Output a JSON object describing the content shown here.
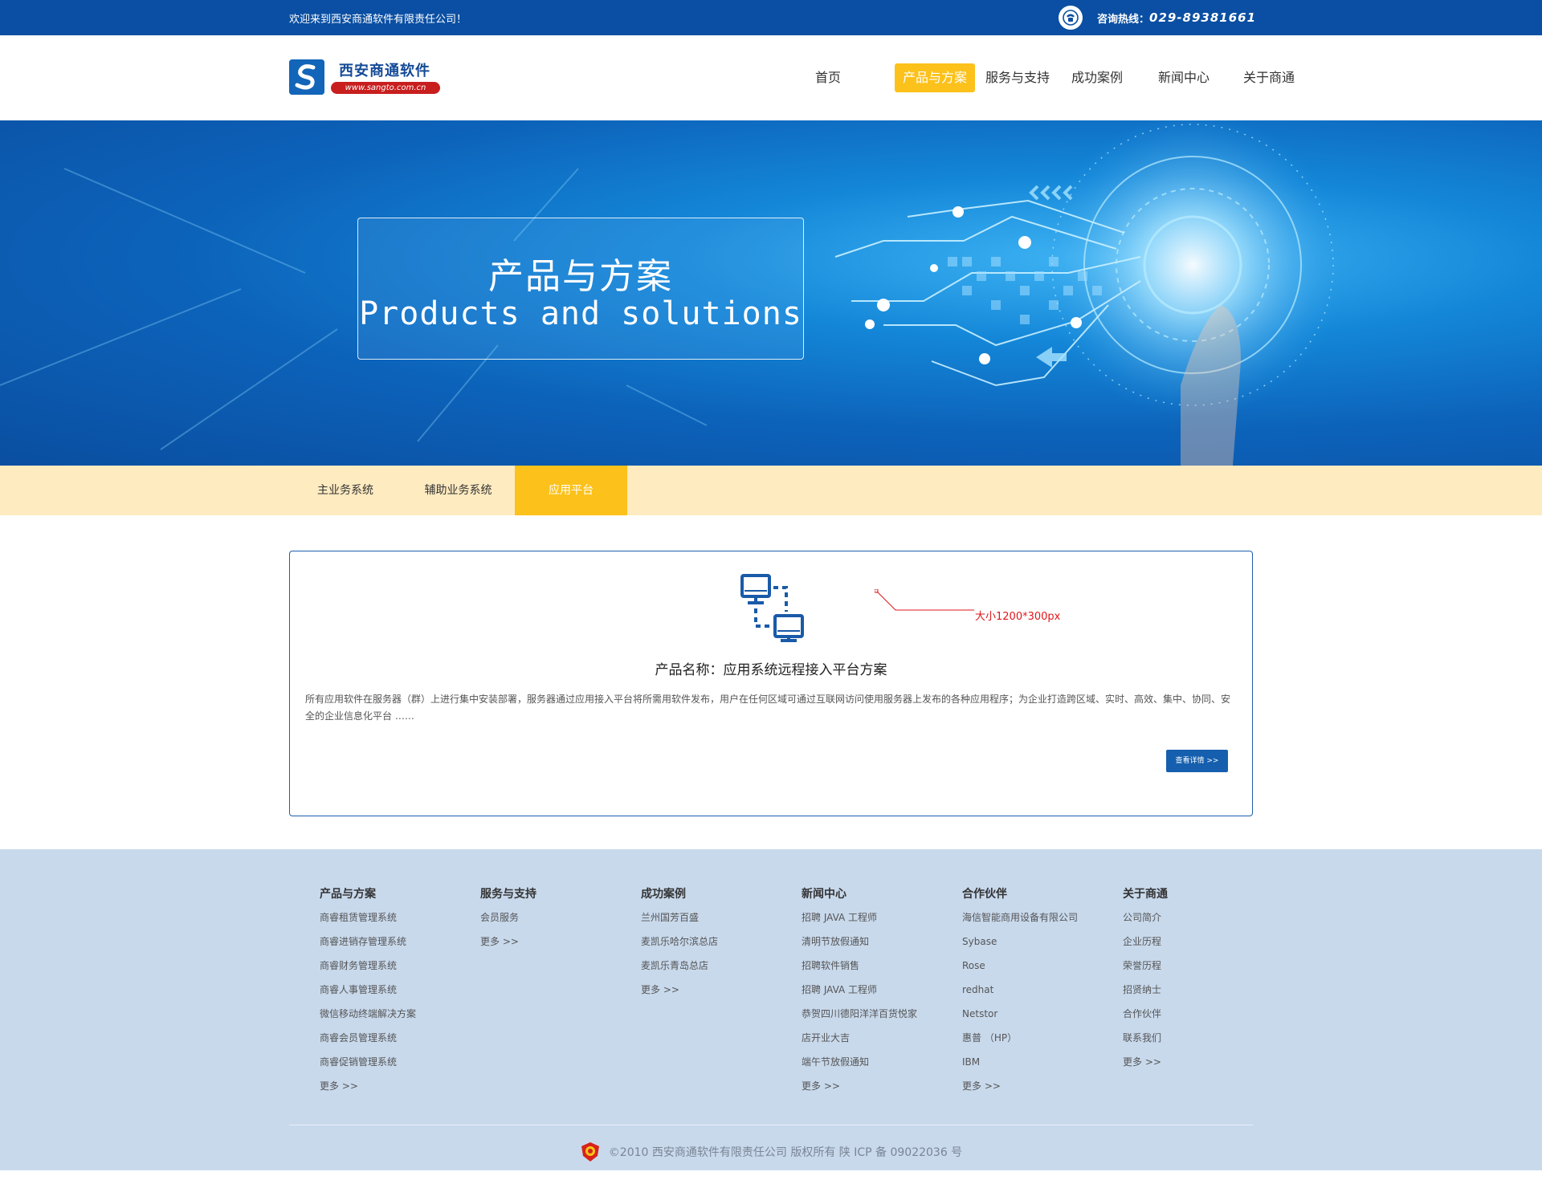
{
  "topbar": {
    "welcome": "欢迎来到西安商通软件有限责任公司！",
    "hotline_label": "咨询热线：",
    "hotline_number": "029-89381661",
    "phone_icon": "phone-icon"
  },
  "header": {
    "logo_name": "西安商通软件",
    "logo_url": "www.sangto.com.cn",
    "nav": [
      {
        "label": "首页",
        "active": false
      },
      {
        "label": "产品与方案",
        "active": true
      },
      {
        "label": "服务与支持",
        "active": false
      },
      {
        "label": "成功案例",
        "active": false
      },
      {
        "label": "新闻中心",
        "active": false
      },
      {
        "label": "关于商通",
        "active": false
      }
    ]
  },
  "banner": {
    "title": "产品与方案",
    "subtitle": "Products and solutions"
  },
  "subtabs": [
    {
      "label": "主业务系统",
      "active": false
    },
    {
      "label": "辅助业务系统",
      "active": false
    },
    {
      "label": "应用平台",
      "active": true
    }
  ],
  "card": {
    "annotation": "大小1200*300px",
    "product_name": "产品名称：应用系统远程接入平台方案",
    "description": "所有应用软件在服务器（群）上进行集中安装部署，服务器通过应用接入平台将所需用软件发布，用户在任何区域可通过互联网访问使用服务器上发布的各种应用程序；为企业打造跨区域、实时、高效、集中、协同、安全的企业信息化平台 ……",
    "detail_button": "查看详情 >>"
  },
  "footer": {
    "columns": [
      {
        "title": "产品与方案",
        "links": [
          "商睿租赁管理系统",
          "商睿进销存管理系统",
          "商睿财务管理系统",
          "商睿人事管理系统",
          "微信移动终端解决方案",
          "商睿会员管理系统",
          "商睿促销管理系统",
          "更多 >>"
        ]
      },
      {
        "title": "服务与支持",
        "links": [
          "会员服务",
          "更多 >>"
        ]
      },
      {
        "title": "成功案例",
        "links": [
          "兰州国芳百盛",
          "麦凯乐哈尔滨总店",
          "麦凯乐青岛总店",
          "更多 >>"
        ]
      },
      {
        "title": "新闻中心",
        "links": [
          "招聘 JAVA 工程师",
          "清明节放假通知",
          "招聘软件销售",
          "招聘 JAVA 工程师",
          "恭贺四川德阳洋洋百货悦家",
          "店开业大吉",
          "端午节放假通知",
          "更多 >>"
        ]
      },
      {
        "title": "合作伙伴",
        "links": [
          "海信智能商用设备有限公司",
          "Sybase",
          "Rose",
          "redhat",
          "Netstor",
          "惠普 （HP）",
          "IBM",
          "更多 >>"
        ]
      },
      {
        "title": "关于商通",
        "links": [
          "公司简介",
          "企业历程",
          "荣誉历程",
          "招贤纳士",
          "合作伙伴",
          "联系我们",
          "更多 >>"
        ]
      }
    ],
    "copyright": "©2010 西安商通软件有限责任公司 版权所有    陕 ICP 备 09022036 号"
  },
  "colors": {
    "topbar": "#0a4fa3",
    "accent": "#fcc11a",
    "subtab_bg": "#feebc0",
    "card_border": "#1c5fae",
    "footer_bg": "#c8d9ec"
  }
}
